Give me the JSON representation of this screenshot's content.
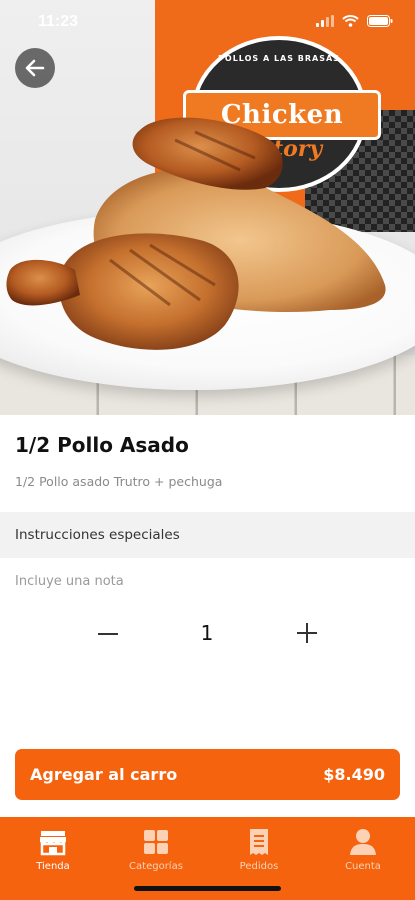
{
  "status": {
    "time": "11:23"
  },
  "hero": {
    "logo_top": "POLLOS A LAS BRASAS",
    "logo_main": "Chicken",
    "logo_sub": "factory"
  },
  "product": {
    "title": "1/2 Pollo Asado",
    "description": "1/2 Pollo asado Trutro + pechuga",
    "instructions_label": "Instrucciones especiales",
    "note_placeholder": "Incluye una nota",
    "quantity": "1"
  },
  "cart": {
    "add_label": "Agregar al carro",
    "price": "$8.490"
  },
  "tabs": [
    {
      "label": "Tienda",
      "icon": "store-icon",
      "active": true
    },
    {
      "label": "Categorías",
      "icon": "grid-icon",
      "active": false
    },
    {
      "label": "Pedidos",
      "icon": "receipt-icon",
      "active": false
    },
    {
      "label": "Cuenta",
      "icon": "user-icon",
      "active": false
    }
  ],
  "colors": {
    "accent": "#f5630f",
    "tab_muted": "#fbd2b6"
  }
}
